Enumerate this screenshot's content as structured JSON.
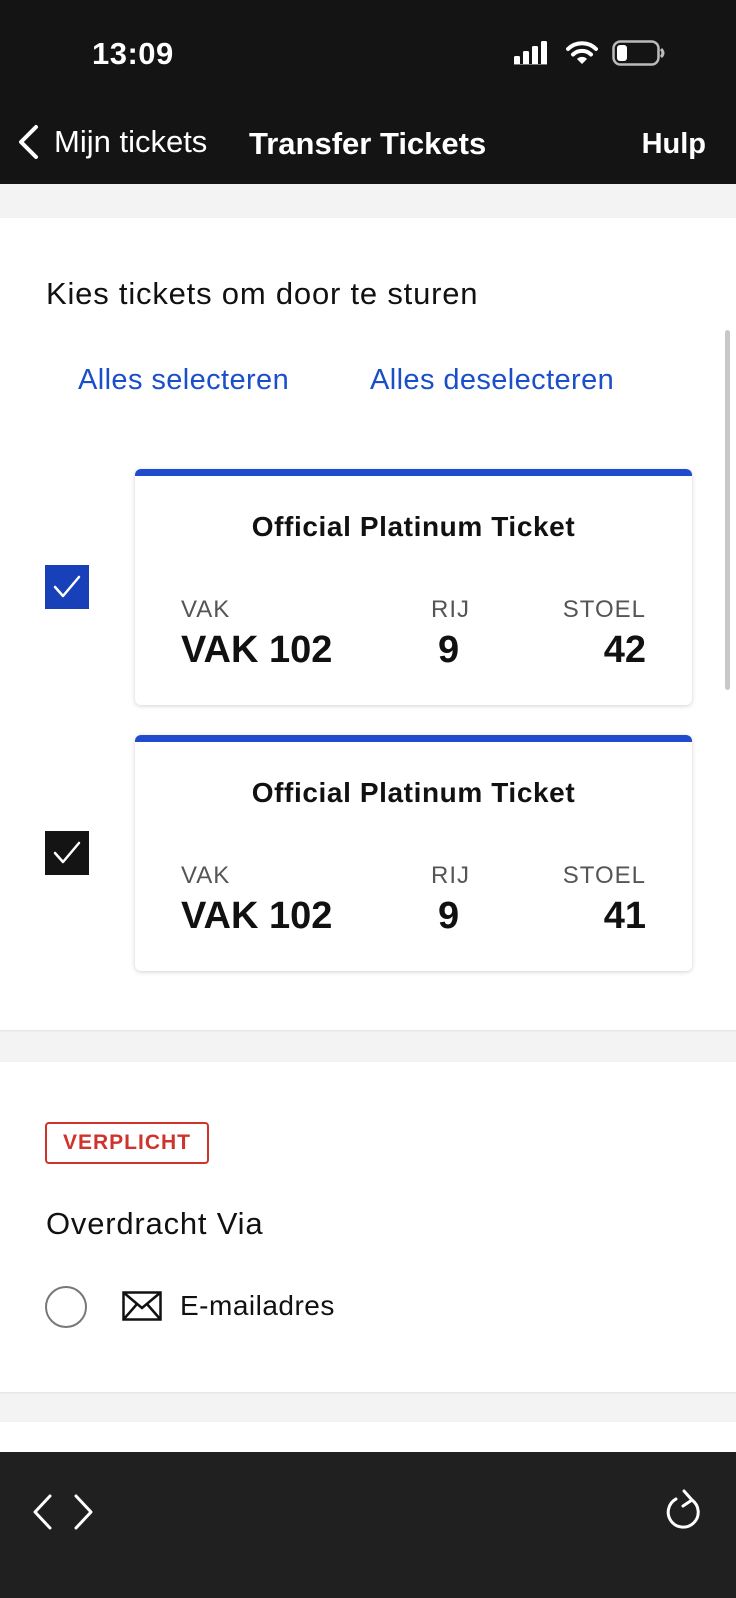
{
  "status": {
    "time": "13:09"
  },
  "nav": {
    "back_label": "Mijn tickets",
    "title": "Transfer Tickets",
    "help_label": "Hulp"
  },
  "tickets_section": {
    "title": "Kies tickets om door te sturen",
    "select_all": "Alles selecteren",
    "deselect_all": "Alles deselecteren",
    "tickets": [
      {
        "name": "Official Platinum Ticket",
        "section_label": "VAK",
        "section": "VAK 102",
        "row_label": "RIJ",
        "row": "9",
        "seat_label": "STOEL",
        "seat": "42",
        "checked": true
      },
      {
        "name": "Official Platinum Ticket",
        "section_label": "VAK",
        "section": "VAK 102",
        "row_label": "RIJ",
        "row": "9",
        "seat_label": "STOEL",
        "seat": "41",
        "checked": true
      }
    ]
  },
  "transfer_section": {
    "badge": "VERPLICHT",
    "title": "Overdracht Via",
    "options": [
      {
        "label": "E-mailadres",
        "icon": "envelope-icon",
        "selected": false
      }
    ]
  },
  "colors": {
    "accent": "#1f4ccc",
    "link": "#1a4fc9",
    "required": "#d0332b",
    "bar": "#141414"
  }
}
